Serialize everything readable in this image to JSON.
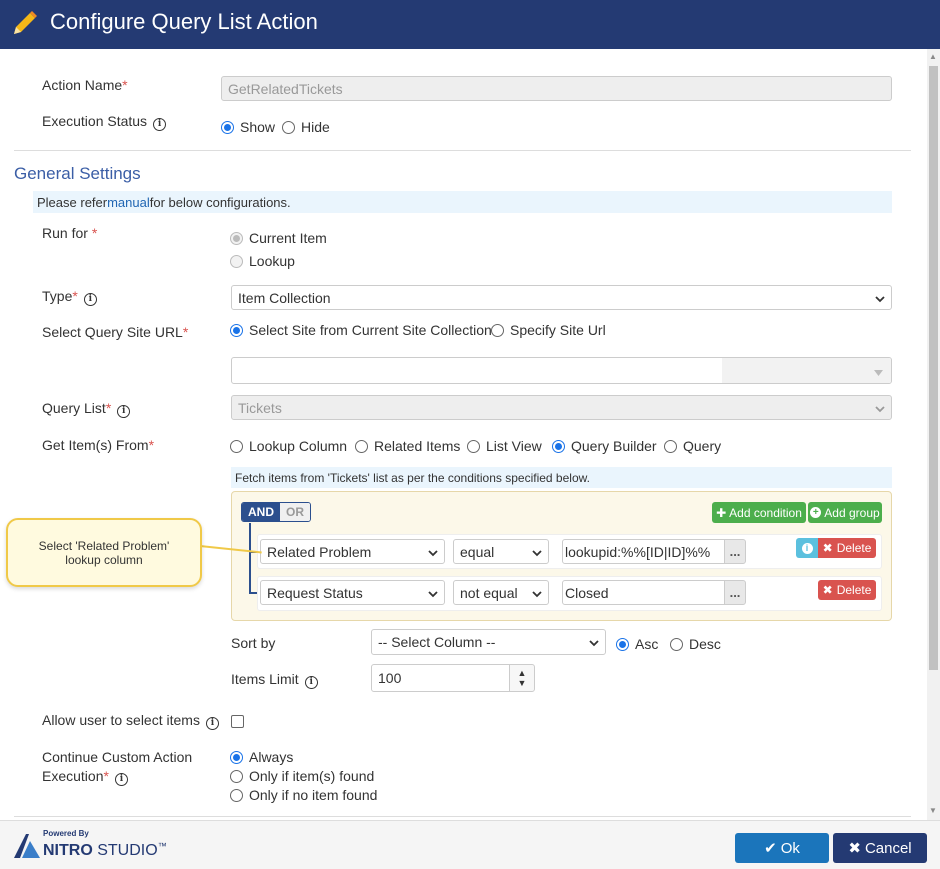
{
  "header": {
    "title": "Configure Query List Action"
  },
  "action_name": {
    "label": "Action Name",
    "required": "*",
    "value": "GetRelatedTickets"
  },
  "execution_status": {
    "label": "Execution Status",
    "options": [
      "Show",
      "Hide"
    ],
    "selected": "Show"
  },
  "general_settings": {
    "title": "General Settings",
    "note_prefix": "Please refer ",
    "note_link": "manual",
    "note_suffix": " for below configurations."
  },
  "run_for": {
    "label": "Run for",
    "required": "*",
    "options": [
      "Current Item",
      "Lookup"
    ],
    "selected": "Current Item"
  },
  "type": {
    "label": "Type",
    "required": "*",
    "value": "Item Collection"
  },
  "query_site_url": {
    "label": "Select Query Site URL",
    "required": "*",
    "options": [
      "Select Site from Current Site Collection",
      "Specify Site Url"
    ],
    "selected": "Select Site from Current Site Collection",
    "site_value": ""
  },
  "query_list": {
    "label": "Query List",
    "required": "*",
    "value": "Tickets"
  },
  "get_items_from": {
    "label": "Get Item(s) From",
    "required": "*",
    "options": [
      "Lookup Column",
      "Related Items",
      "List View",
      "Query Builder",
      "Query"
    ],
    "selected": "Query Builder"
  },
  "query_builder": {
    "note": "Fetch items from 'Tickets' list as per the conditions specified below.",
    "and_label": "AND",
    "or_label": "OR",
    "add_condition": "Add condition",
    "add_group": "Add group",
    "delete_label": "Delete",
    "rules": [
      {
        "field": "Related Problem",
        "operator": "equal",
        "value": "lookupid:%%[ID|ID]%%"
      },
      {
        "field": "Request Status",
        "operator": "not equal",
        "value": "Closed"
      }
    ],
    "ellipsis": "..."
  },
  "sort_by": {
    "label": "Sort by",
    "value": "-- Select Column --",
    "options": [
      "Asc",
      "Desc"
    ],
    "selected": "Asc"
  },
  "items_limit": {
    "label": "Items Limit",
    "value": "100"
  },
  "allow_select": {
    "label": "Allow user to select items",
    "checked": false
  },
  "continue_execution": {
    "label_line1": "Continue Custom Action",
    "label_line2": "Execution",
    "required": "*",
    "options": [
      "Always",
      "Only if item(s) found",
      "Only if no item found"
    ],
    "selected": "Always"
  },
  "callout": {
    "line1": "Select 'Related Problem'",
    "line2": "lookup column"
  },
  "footer": {
    "brand_small": "Powered By",
    "brand_main": "NITRO",
    "brand_sub": "STUDIO",
    "brand_tm": "™",
    "ok_label": "Ok",
    "cancel_label": "Cancel"
  },
  "colors": {
    "header": "#243a73",
    "accent": "#1a73e8",
    "green": "#4cae4c",
    "red": "#d9534f",
    "callout_border": "#f0c948"
  }
}
